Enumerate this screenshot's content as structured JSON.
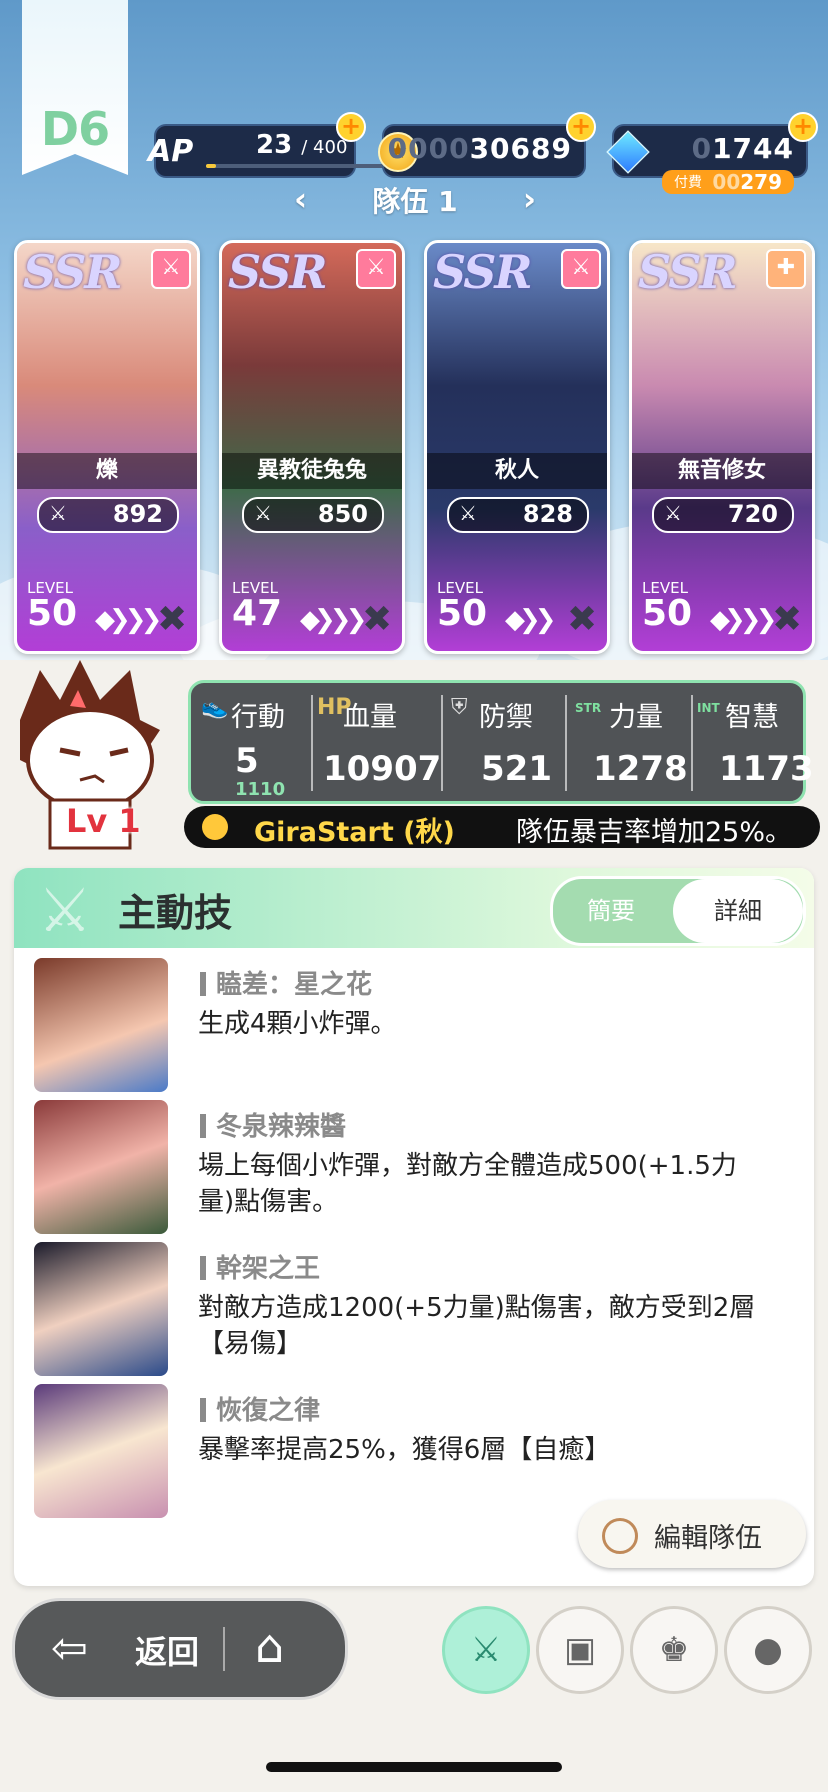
{
  "banner": {
    "label": "D6"
  },
  "ap": {
    "label": "AP",
    "value": "23",
    "max": "/ 400",
    "progress_percent": 5.75
  },
  "coins": {
    "dim_digits": "0000",
    "digits": "30689"
  },
  "gems": {
    "dim_digits": "0",
    "digits": "1744",
    "paid_label": "付費",
    "paid_dim": "00",
    "paid_value": "279"
  },
  "team": {
    "title": "隊伍 1",
    "prev": "‹",
    "next": "›"
  },
  "cards": [
    {
      "rarity": "SSR",
      "name": "爍",
      "power": "892",
      "level_label": "LEVEL",
      "level": "50",
      "role": "attack"
    },
    {
      "rarity": "SSR",
      "name": "異教徒兔兔",
      "power": "850",
      "level_label": "LEVEL",
      "level": "47",
      "role": "attack"
    },
    {
      "rarity": "SSR",
      "name": "秋人",
      "power": "828",
      "level_label": "LEVEL",
      "level": "50",
      "role": "attack"
    },
    {
      "rarity": "SSR",
      "name": "無音修女",
      "power": "720",
      "level_label": "LEVEL",
      "level": "50",
      "role": "heal"
    }
  ],
  "leader": {
    "level_tag": "Lv 1"
  },
  "stats": {
    "action": {
      "label": "行動",
      "value": "5",
      "sub": "1110"
    },
    "hp": {
      "label": "血量",
      "icon": "HP",
      "value": "10907"
    },
    "defense": {
      "label": "防禦",
      "value": "521"
    },
    "strength": {
      "label": "力量",
      "icon": "STR",
      "value": "1278"
    },
    "wisdom": {
      "label": "智慧",
      "icon": "INT",
      "value": "1173"
    }
  },
  "gira": {
    "name": "GiraStart (秋)",
    "desc": "隊伍暴吉率增加25%。"
  },
  "panel": {
    "title": "主動技",
    "brief": "簡要",
    "detail": "詳細"
  },
  "skills": [
    {
      "name": "瞌差：星之花",
      "desc": "生成4顆小炸彈。"
    },
    {
      "name": "冬泉辣辣醬",
      "desc": "場上每個小炸彈，對敵方全體造成500(+1.5力量)點傷害。"
    },
    {
      "name": "幹架之王",
      "desc": "對敵方造成1200(+5力量)點傷害，敵方受到2層【易傷】"
    },
    {
      "name": "恢復之律",
      "desc": "暴擊率提高25%，獲得6層【自癒】"
    }
  ],
  "edit": {
    "label": "編輯隊伍"
  },
  "bottom": {
    "back": "返回"
  },
  "colors": {
    "accent": "#8fe3c0",
    "dark_bar": "#1d2b48",
    "gold": "#ffd22e"
  }
}
